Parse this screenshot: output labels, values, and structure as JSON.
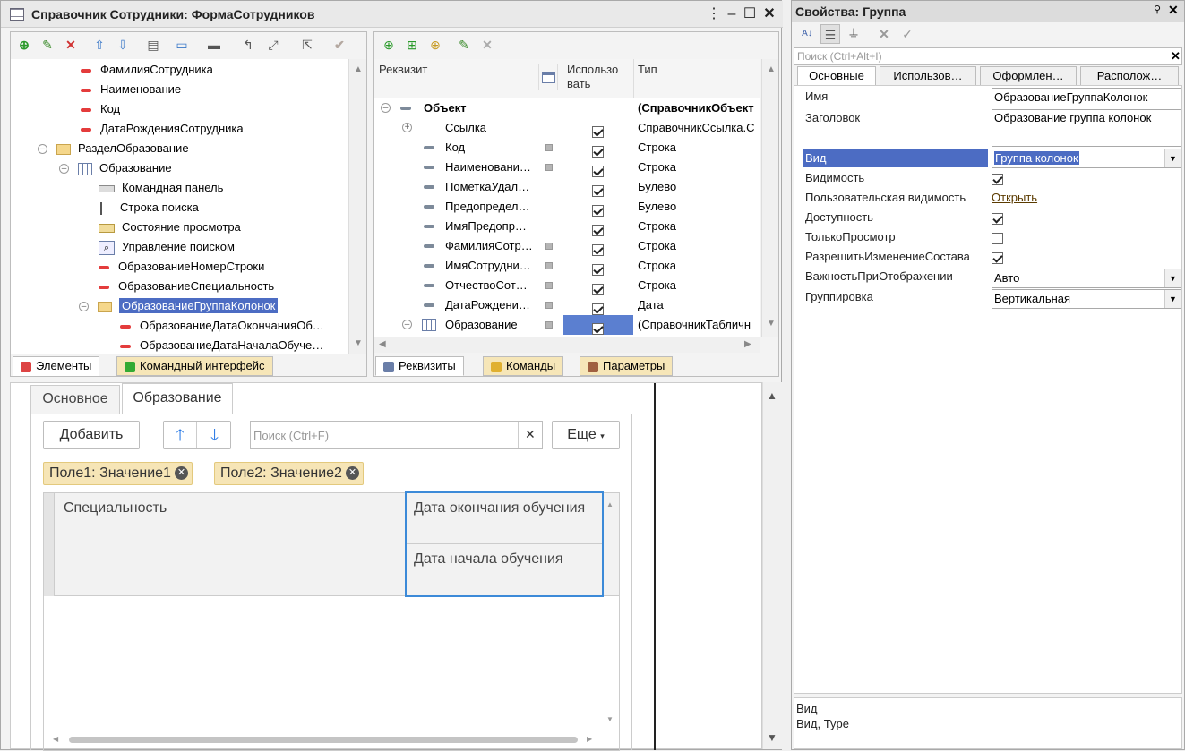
{
  "window": {
    "title": "Справочник Сотрудники: ФормаСотрудников"
  },
  "tree": {
    "items": [
      {
        "label": "ФамилияСотрудника",
        "icon": "field-red-icon"
      },
      {
        "label": "Наименование",
        "icon": "field-red-icon"
      },
      {
        "label": "Код",
        "icon": "field-red-icon"
      },
      {
        "label": "ДатаРожденияСотрудника",
        "icon": "field-red-icon"
      },
      {
        "label": "РазделОбразование",
        "icon": "folder-icon"
      },
      {
        "label": "Образование",
        "icon": "table-icon"
      },
      {
        "label": "Командная панель",
        "icon": "command-panel-icon"
      },
      {
        "label": "Строка поиска",
        "icon": "search-string-icon"
      },
      {
        "label": "Состояние просмотра",
        "icon": "view-state-icon"
      },
      {
        "label": "Управление поиском",
        "icon": "search-control-icon"
      },
      {
        "label": "ОбразованиеНомерСтроки",
        "icon": "field-red-icon"
      },
      {
        "label": "ОбразованиеСпециальность",
        "icon": "field-red-icon"
      },
      {
        "label": "ОбразованиеГруппаКолонок",
        "icon": "folder-icon"
      },
      {
        "label": "ОбразованиеДатаОкончанияОб…",
        "icon": "field-red-icon"
      },
      {
        "label": "ОбразованиеДатаНачалаОбуче…",
        "icon": "field-red-icon"
      }
    ]
  },
  "left_tabs": {
    "elements": "Элементы",
    "command_interface": "Командный интерфейс"
  },
  "attrs": {
    "headers": {
      "attr": "Реквизит",
      "use": "Использо вать",
      "type": "Тип"
    },
    "rows": [
      {
        "name": "Объект",
        "type": "(СправочникОбъект"
      },
      {
        "name": "Ссылка",
        "type": "СправочникСсылка.С"
      },
      {
        "name": "Код",
        "type": "Строка"
      },
      {
        "name": "Наименовани…",
        "type": "Строка"
      },
      {
        "name": "ПометкаУдал…",
        "type": "Булево"
      },
      {
        "name": "Предопредел…",
        "type": "Булево"
      },
      {
        "name": "ИмяПредопр…",
        "type": "Строка"
      },
      {
        "name": "ФамилияСотр…",
        "type": "Строка"
      },
      {
        "name": "ИмяСотрудни…",
        "type": "Строка"
      },
      {
        "name": "ОтчествоСот…",
        "type": "Строка"
      },
      {
        "name": "ДатаРождени…",
        "type": "Дата"
      },
      {
        "name": "Образование",
        "type": "(СправочникТабличн"
      }
    ]
  },
  "mid_tabs": {
    "attrs": "Реквизиты",
    "commands": "Команды",
    "params": "Параметры"
  },
  "preview": {
    "tabs": {
      "main": "Основное",
      "education": "Образование"
    },
    "add_button": "Добавить",
    "search_placeholder": "Поиск (Ctrl+F)",
    "more_button": "Еще",
    "chips": [
      {
        "label": "Поле1: Значение1"
      },
      {
        "label": "Поле2: Значение2"
      }
    ],
    "columns": {
      "specialty": "Специальность",
      "end_date": "Дата окончания обучения",
      "start_date": "Дата начала обучения"
    }
  },
  "props": {
    "title": "Свойства: Группа",
    "search_placeholder": "Поиск (Ctrl+Alt+I)",
    "tabs": {
      "main": "Основные",
      "use": "Использов…",
      "design": "Оформлен…",
      "layout": "Располож…"
    },
    "labels": {
      "name": "Имя",
      "header": "Заголовок",
      "kind": "Вид",
      "visible": "Видимость",
      "user_visible": "Пользовательская видимость",
      "enabled": "Доступность",
      "readonly": "ТолькоПросмотр",
      "allow_change": "РазрешитьИзменениеСостава",
      "importance": "ВажностьПриОтображении",
      "grouping": "Группировка"
    },
    "values": {
      "name": "ОбразованиеГруппаКолонок",
      "header": "Образование группа колонок",
      "kind": "Группа колонок",
      "user_visible": "Открыть",
      "importance": "Авто",
      "grouping": "Вертикальная"
    },
    "help": {
      "title": "Вид",
      "text": "Вид, Type"
    }
  }
}
